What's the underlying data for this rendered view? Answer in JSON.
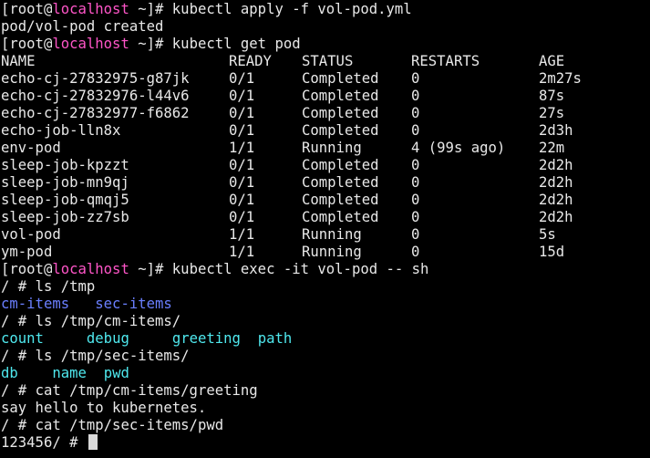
{
  "prompt": {
    "user": "[root",
    "at": "@",
    "host": "localhost",
    "path_suffix": " ~]# "
  },
  "lines": {
    "cmd_apply": "kubectl apply -f vol-pod.yml",
    "apply_result": "pod/vol-pod created",
    "cmd_get": "kubectl get pod",
    "cmd_exec": "kubectl exec -it vol-pod -- sh",
    "sh_prompt": "/ # ",
    "cmd_ls_tmp": "ls /tmp",
    "cmd_ls_cm": "ls /tmp/cm-items/",
    "cmd_ls_sec": "ls /tmp/sec-items/",
    "cmd_cat_greeting": "cat /tmp/cm-items/greeting",
    "greeting_output": "say hello to kubernetes.",
    "cmd_cat_pwd": "cat /tmp/sec-items/pwd",
    "final_line": "123456/ # "
  },
  "pod_table": {
    "headers": [
      "NAME",
      "READY",
      "STATUS",
      "RESTARTS",
      "AGE"
    ],
    "rows": [
      [
        "echo-cj-27832975-g87jk",
        "0/1",
        "Completed",
        "0",
        "2m27s"
      ],
      [
        "echo-cj-27832976-l44v6",
        "0/1",
        "Completed",
        "0",
        "87s"
      ],
      [
        "echo-cj-27832977-f6862",
        "0/1",
        "Completed",
        "0",
        "27s"
      ],
      [
        "echo-job-lln8x",
        "0/1",
        "Completed",
        "0",
        "2d3h"
      ],
      [
        "env-pod",
        "1/1",
        "Running",
        "4 (99s ago)",
        "22m"
      ],
      [
        "sleep-job-kpzzt",
        "0/1",
        "Completed",
        "0",
        "2d2h"
      ],
      [
        "sleep-job-mn9qj",
        "0/1",
        "Completed",
        "0",
        "2d2h"
      ],
      [
        "sleep-job-qmqj5",
        "0/1",
        "Completed",
        "0",
        "2d2h"
      ],
      [
        "sleep-job-zz7sb",
        "0/1",
        "Completed",
        "0",
        "2d2h"
      ],
      [
        "vol-pod",
        "1/1",
        "Running",
        "0",
        "5s"
      ],
      [
        "ym-pod",
        "1/1",
        "Running",
        "0",
        "15d"
      ]
    ]
  },
  "ls_tmp": {
    "a": "cm-items",
    "b": "sec-items"
  },
  "ls_cm": {
    "a": "count",
    "b": "debug",
    "c": "greeting",
    "d": "path"
  },
  "ls_sec": {
    "a": "db",
    "b": "name",
    "c": "pwd"
  },
  "colors": {
    "background": "#000000",
    "foreground": "#e8e8e8",
    "hostname": "#ff55c8",
    "directory": "#6a7fff",
    "symlink": "#4fe8ee"
  }
}
